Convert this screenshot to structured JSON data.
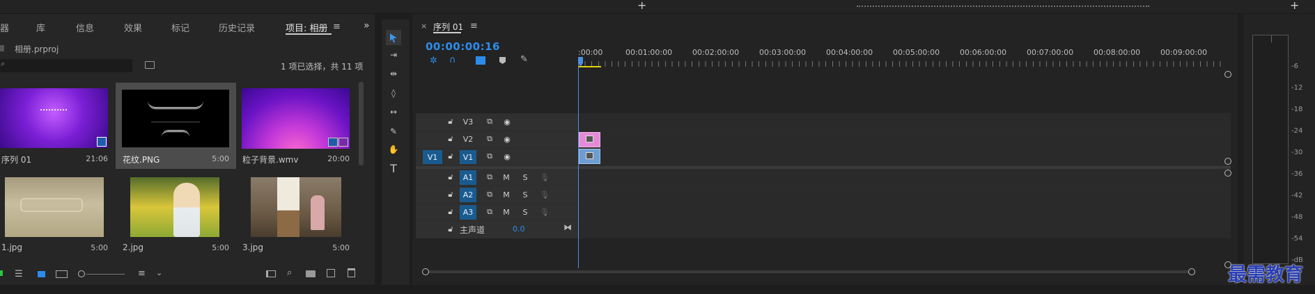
{
  "project_panel": {
    "tabs": [
      "器",
      "库",
      "信息",
      "效果",
      "标记",
      "历史记录",
      "项目: 相册"
    ],
    "active_tab": "项目: 相册",
    "file_name": "相册.prproj",
    "search_placeholder": "",
    "selection_status": "1 项已选择，共 11 项",
    "items": [
      {
        "name": "序列 01",
        "duration": "21:06"
      },
      {
        "name": "花纹.PNG",
        "duration": "5:00"
      },
      {
        "name": "粒子背景.wmv",
        "duration": "20:00"
      },
      {
        "name": "1.jpg",
        "duration": "5:00"
      },
      {
        "name": "2.jpg",
        "duration": "5:00"
      },
      {
        "name": "3.jpg",
        "duration": "5:00"
      }
    ]
  },
  "timeline": {
    "tab_label": "序列 01",
    "timecode": "00:00:00:16",
    "ruler_labels": [
      ":00:00",
      "00:01:00:00",
      "00:02:00:00",
      "00:03:00:00",
      "00:04:00:00",
      "00:05:00:00",
      "00:06:00:00",
      "00:07:00:00",
      "00:08:00:00",
      "00:09:00:00"
    ],
    "video_tracks": [
      "V3",
      "V2",
      "V1"
    ],
    "source_patch": "V1",
    "audio_tracks": [
      "A1",
      "A2",
      "A3"
    ],
    "mute_label": "M",
    "solo_label": "S",
    "master_label": "主声道",
    "master_value": "0.0"
  },
  "audio_meter": {
    "labels": [
      "-6",
      "-12",
      "-18",
      "-24",
      "-30",
      "-36",
      "-42",
      "-48",
      "-54",
      "-dB"
    ]
  },
  "watermark": "最需教育",
  "colors": {
    "accent_blue": "#2d8ceb",
    "track_blue": "#1a5b8f",
    "clip_pink": "#e58ad8",
    "clip_blue": "#6e9dd1",
    "playhead": "#4a90e2"
  }
}
